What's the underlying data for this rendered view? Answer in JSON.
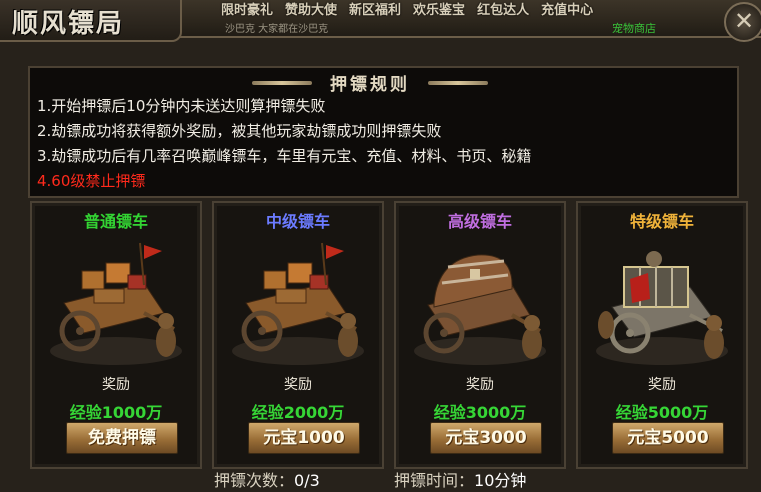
{
  "topbar": {
    "menu": [
      "限时豪礼",
      "赞助大使",
      "新区福利",
      "欢乐鉴宝",
      "红包达人",
      "充值中心"
    ],
    "subline": "沙巴克 大家都在沙巴克",
    "shop_link": "宠物商店"
  },
  "window": {
    "title": "顺风镖局",
    "close_glyph": "✕"
  },
  "rules": {
    "header": "押镖规则",
    "lines": [
      "1.开始押镖后10分钟内未送达则算押镖失败",
      "2.劫镖成功将获得额外奖励，被其他玩家劫镖成功则押镖失败",
      "3.劫镖成功后有几率召唤巅峰镖车，车里有元宝、充值、材料、书页、秘籍"
    ],
    "warning": "4.60级禁止押镖"
  },
  "carts": [
    {
      "title": "普通镖车",
      "title_color": "#33d433",
      "reward_label": "奖励",
      "exp": "经验1000万",
      "button": "免费押镖"
    },
    {
      "title": "中级镖车",
      "title_color": "#6b7bff",
      "reward_label": "奖励",
      "exp": "经验2000万",
      "button": "元宝1000"
    },
    {
      "title": "高级镖车",
      "title_color": "#c06ee0",
      "reward_label": "奖励",
      "exp": "经验3000万",
      "button": "元宝3000"
    },
    {
      "title": "特级镖车",
      "title_color": "#f0b33a",
      "reward_label": "奖励",
      "exp": "经验5000万",
      "button": "元宝5000"
    }
  ],
  "footer": {
    "count_label": "押镖次数：",
    "count_value": "0/3",
    "time_label": "押镖时间：",
    "time_value": "10分钟"
  }
}
